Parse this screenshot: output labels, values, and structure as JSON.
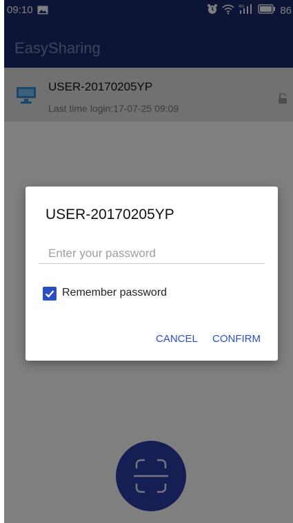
{
  "status_bar": {
    "time": "09:10",
    "battery": "86"
  },
  "app_bar": {
    "title": "EasySharing"
  },
  "device": {
    "name": "USER-20170205YP",
    "last_login": "Last time login:17-07-25 09:09"
  },
  "dialog": {
    "title": "USER-20170205YP",
    "password_placeholder": "Enter your password",
    "password_value": "",
    "remember_label": "Remember password",
    "remember_checked": true,
    "cancel_label": "CANCEL",
    "confirm_label": "CONFIRM"
  },
  "colors": {
    "app_bar": "#1a2a6e",
    "accent": "#2a4fc4",
    "fab": "#2a3fa8"
  },
  "icons": [
    "image-icon",
    "alarm-icon",
    "wifi-icon",
    "signal-icon",
    "battery-icon",
    "computer-icon",
    "unlock-icon",
    "scan-icon",
    "check-icon"
  ]
}
